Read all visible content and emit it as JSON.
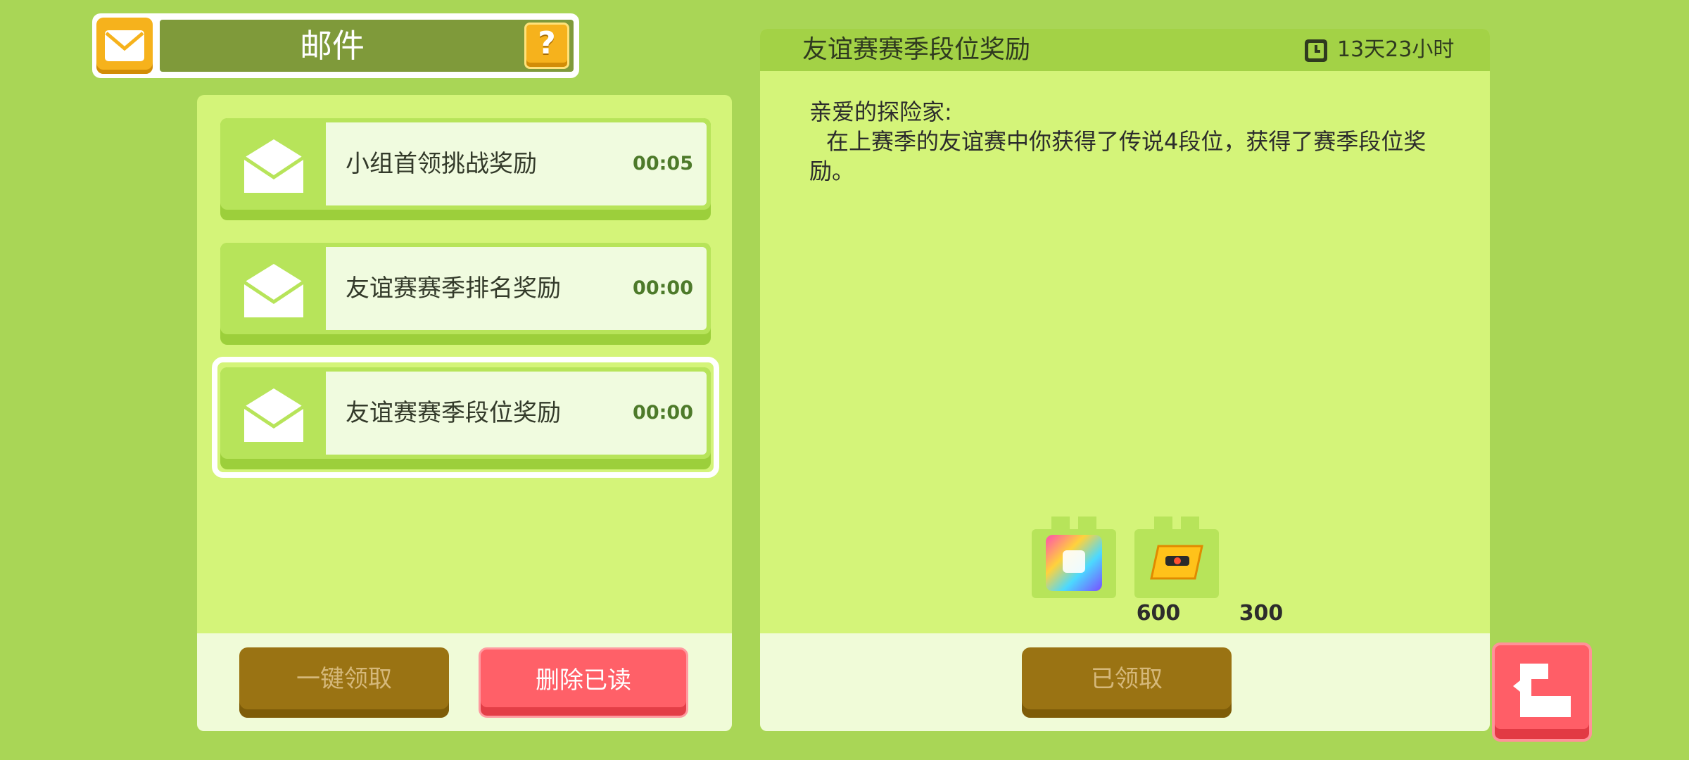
{
  "header": {
    "title": "邮件",
    "help_label": "?"
  },
  "mail_list": [
    {
      "subject": "小组首领挑战奖励",
      "time": "00:05"
    },
    {
      "subject": "友谊赛赛季排名奖励",
      "time": "00:00"
    },
    {
      "subject": "友谊赛赛季段位奖励",
      "time": "00:00",
      "selected": true
    }
  ],
  "left_actions": {
    "claim_all_label": "一键领取",
    "delete_read_label": "删除已读"
  },
  "detail": {
    "title": "友谊赛赛季段位奖励",
    "timer": "13天23小时",
    "greeting": "亲爱的探险家:",
    "message": "在上赛季的友谊赛中你获得了传说4段位，获得了赛季段位奖励。",
    "rewards": [
      {
        "item": "rainbow-cube-icon",
        "count": "600"
      },
      {
        "item": "ticket-icon",
        "count": "300"
      }
    ],
    "claimed_label": "已领取"
  },
  "colors": {
    "background": "#a9d656",
    "panel": "#d4f479",
    "accent_red": "#ff5e67",
    "accent_brown": "#9a7313",
    "accent_yellow": "#f6b21c"
  }
}
